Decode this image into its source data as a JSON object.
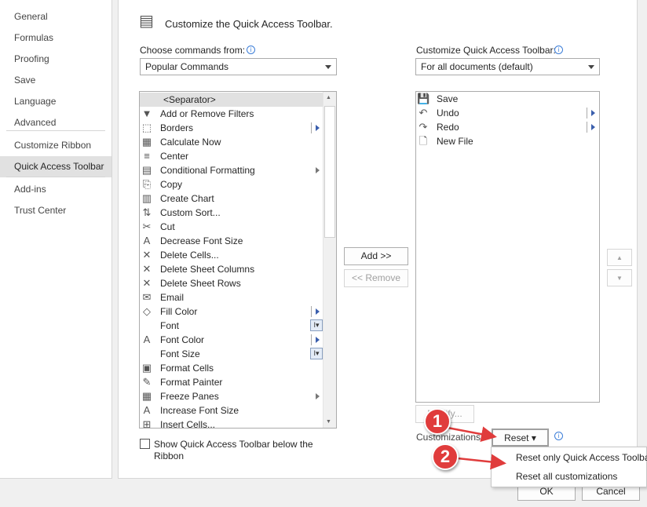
{
  "sidebar": {
    "items": [
      "General",
      "Formulas",
      "Proofing",
      "Save",
      "Language",
      "Advanced",
      "Customize Ribbon",
      "Quick Access Toolbar",
      "Add-ins",
      "Trust Center"
    ],
    "selected": "Quick Access Toolbar"
  },
  "header": {
    "title": "Customize the Quick Access Toolbar."
  },
  "left": {
    "label": "Choose commands from:",
    "select": "Popular Commands",
    "commands": [
      {
        "label": "<Separator>",
        "icon": "",
        "sel": true
      },
      {
        "label": "Add or Remove Filters",
        "icon": "▼"
      },
      {
        "label": "Borders",
        "icon": "⬚",
        "sub": "bar"
      },
      {
        "label": "Calculate Now",
        "icon": "▦"
      },
      {
        "label": "Center",
        "icon": "≡"
      },
      {
        "label": "Conditional Formatting",
        "icon": "▤",
        "sub": "plain"
      },
      {
        "label": "Copy",
        "icon": "⎘"
      },
      {
        "label": "Create Chart",
        "icon": "▥"
      },
      {
        "label": "Custom Sort...",
        "icon": "⇅"
      },
      {
        "label": "Cut",
        "icon": "✂"
      },
      {
        "label": "Decrease Font Size",
        "icon": "A"
      },
      {
        "label": "Delete Cells...",
        "icon": "✕"
      },
      {
        "label": "Delete Sheet Columns",
        "icon": "✕"
      },
      {
        "label": "Delete Sheet Rows",
        "icon": "✕"
      },
      {
        "label": "Email",
        "icon": "✉"
      },
      {
        "label": "Fill Color",
        "icon": "◇",
        "sub": "bar"
      },
      {
        "label": "Font",
        "icon": "",
        "edit": "I▾"
      },
      {
        "label": "Font Color",
        "icon": "A",
        "sub": "bar"
      },
      {
        "label": "Font Size",
        "icon": "",
        "edit": "I▾"
      },
      {
        "label": "Format Cells",
        "icon": "▣"
      },
      {
        "label": "Format Painter",
        "icon": "✎"
      },
      {
        "label": "Freeze Panes",
        "icon": "▦",
        "sub": "plain"
      },
      {
        "label": "Increase Font Size",
        "icon": "A"
      },
      {
        "label": "Insert Cells...",
        "icon": "⊞"
      }
    ],
    "show_below_label": "Show Quick Access Toolbar below the Ribbon"
  },
  "right": {
    "label": "Customize Quick Access Toolbar:",
    "select": "For all documents (default)",
    "items": [
      {
        "label": "Save",
        "icon": "💾"
      },
      {
        "label": "Undo",
        "icon": "↶",
        "sub": "bar"
      },
      {
        "label": "Redo",
        "icon": "↷",
        "sub": "bar"
      },
      {
        "label": "New File",
        "icon": "🗋"
      }
    ],
    "modify_label": "Modify...",
    "customizations_label": "Customizations:",
    "reset_label": "Reset ▾"
  },
  "buttons": {
    "add": "Add >>",
    "remove": "<< Remove",
    "ok": "OK",
    "cancel": "Cancel",
    "up": "▲",
    "down": "▼"
  },
  "reset_menu": [
    "Reset only Quick Access Toolbar",
    "Reset all customizations"
  ],
  "annotations": [
    "1",
    "2"
  ],
  "colors": {
    "annotation": "#e03c3c",
    "selected": "#e1e1e1"
  }
}
